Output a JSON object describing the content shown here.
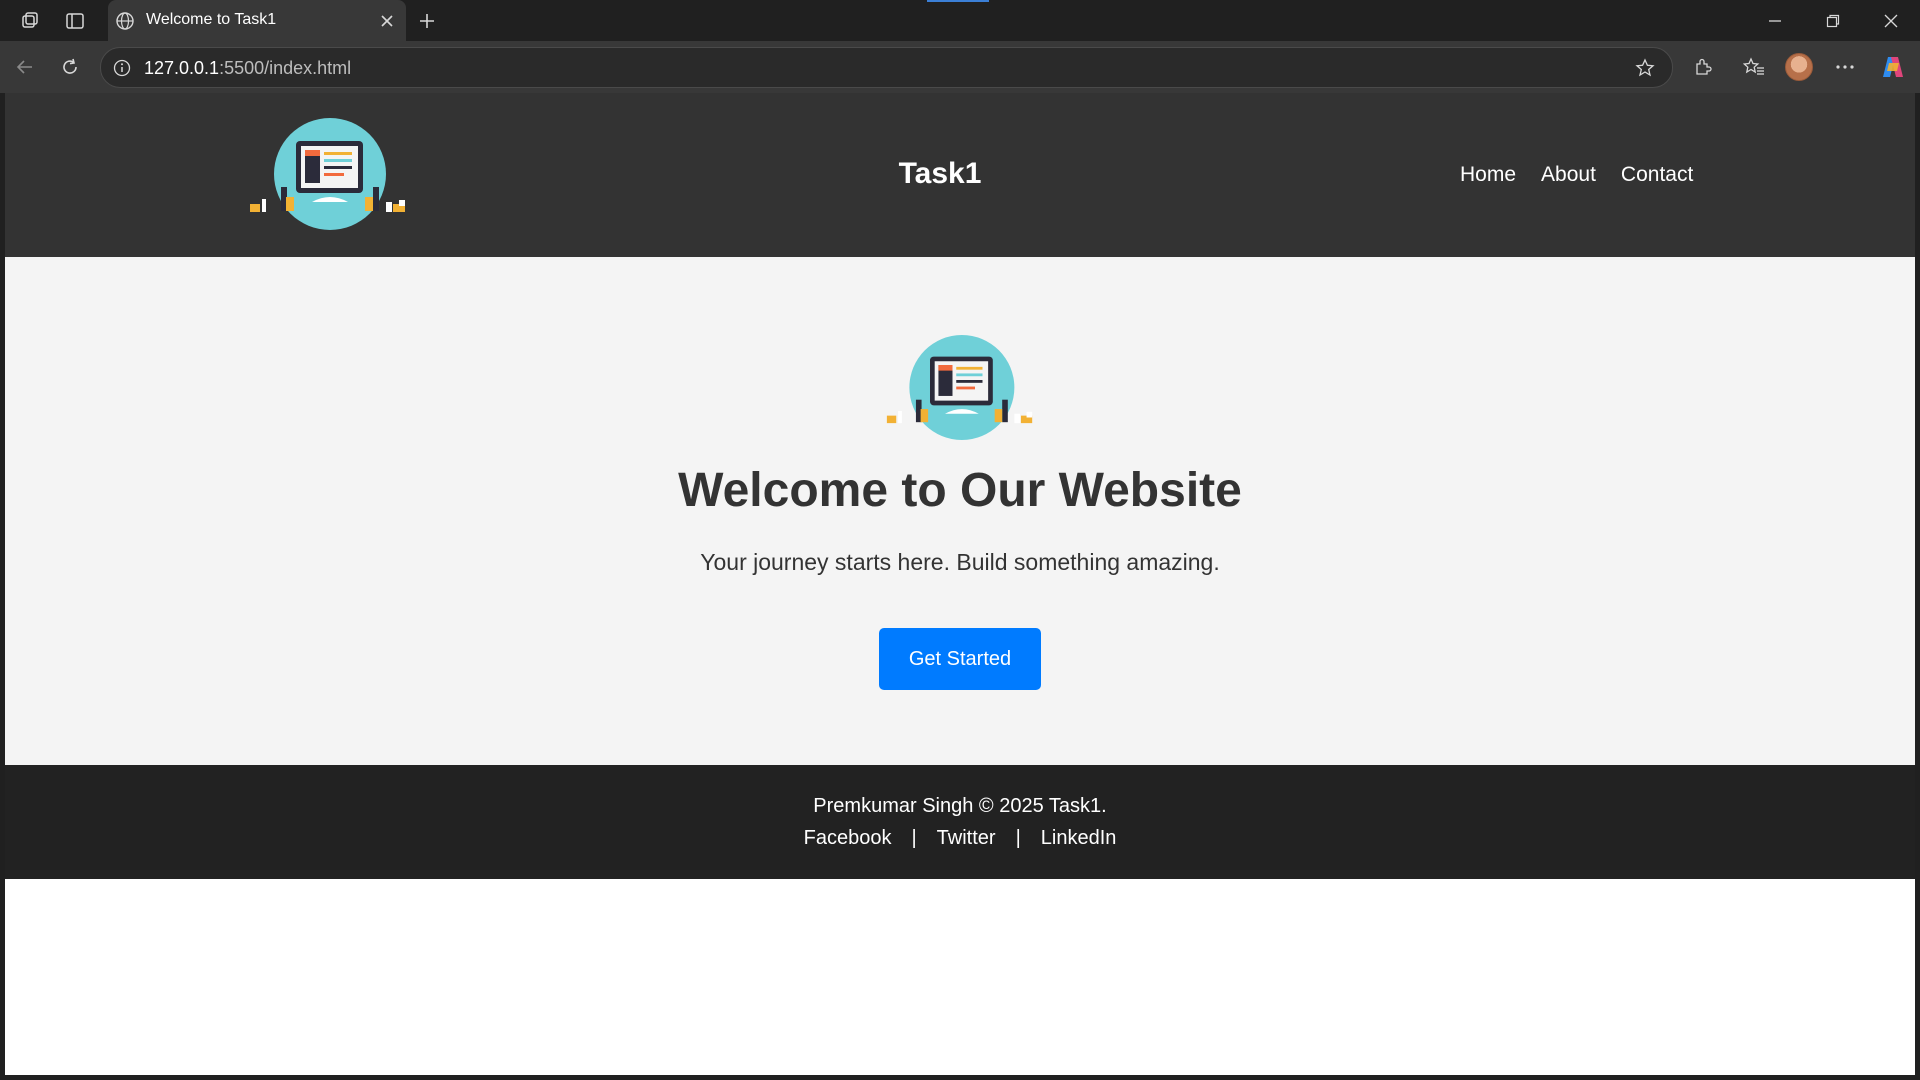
{
  "browser": {
    "tab_title": "Welcome to Task1",
    "url_host": "127.0.0.1",
    "url_path": ":5500/index.html",
    "icons": [
      "workspaces-icon",
      "vertical-tabs-icon",
      "globe-icon",
      "close-icon",
      "new-tab-icon",
      "minimize-icon",
      "restore-icon",
      "window-close-icon",
      "back-icon",
      "refresh-icon",
      "site-info-icon",
      "favorite-star-icon",
      "extensions-icon",
      "favorites-icon",
      "profile-avatar",
      "more-icon",
      "copilot-icon"
    ]
  },
  "header": {
    "title": "Task1",
    "nav": [
      "Home",
      "About",
      "Contact"
    ]
  },
  "hero": {
    "title": "Welcome to Our Website",
    "subtitle": "Your journey starts here. Build something amazing.",
    "cta_label": "Get Started"
  },
  "footer": {
    "copyright": "Premkumar Singh © 2025 Task1.",
    "links": [
      "Facebook",
      "Twitter",
      "LinkedIn"
    ],
    "separator": "|"
  },
  "colors": {
    "header_bg": "#333333",
    "hero_bg": "#f4f4f4",
    "footer_bg": "#222222",
    "cta": "#007bff",
    "logo_circle": "#6fd0d8"
  }
}
